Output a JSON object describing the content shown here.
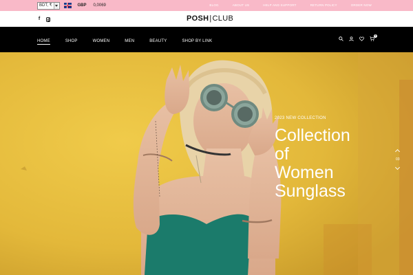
{
  "topbar": {
    "currency_select_value": "BDT, ₹",
    "flag_icon": "uk-flag-icon",
    "currency_code": "GBP",
    "currency_rate": "0,0069",
    "links": [
      "BLOG",
      "ABOUT US",
      "HELP AND SUPPORT",
      "RETURN POLICY",
      "ORDER NOW"
    ],
    "bg_color": "#f9b9c8"
  },
  "logorow": {
    "social_icons": [
      "facebook-icon",
      "instagram-icon"
    ],
    "logo_part1": "POSH",
    "logo_sep": "|",
    "logo_part2": "CLUB"
  },
  "navbar": {
    "links": [
      "HOME",
      "SHOP",
      "WOMEN",
      "MEN",
      "BEAUTY",
      "SHOP BY LINK"
    ],
    "active_index": 0,
    "icons": [
      "search-icon",
      "user-icon",
      "heart-icon",
      "cart-icon"
    ],
    "cart_count": "0",
    "bg_color": "#000000"
  },
  "hero": {
    "subtitle": "2023 NEW COLLECTION",
    "title_lines": [
      "Collection",
      "of",
      "Women",
      "Sunglass"
    ],
    "slide_number": "03",
    "accent_color": "#e5b73a"
  }
}
